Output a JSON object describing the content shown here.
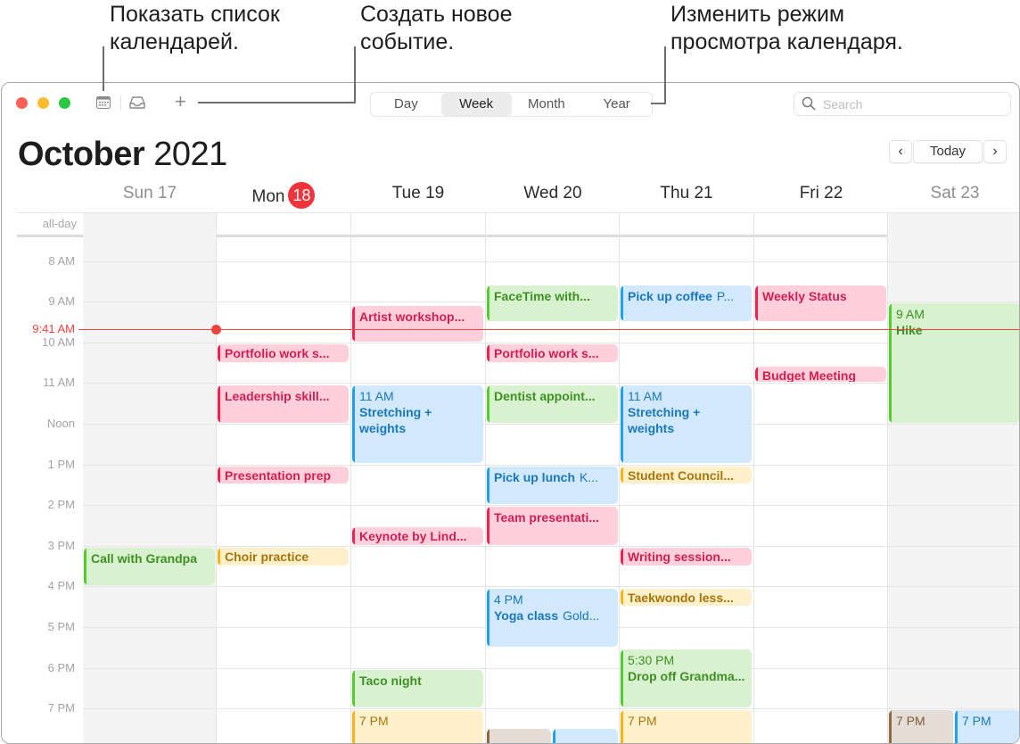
{
  "callouts": [
    {
      "text": "Показать список\nкалендарей."
    },
    {
      "text": "Создать новое\nсобытие."
    },
    {
      "text": "Изменить режим\nпросмотра календаря."
    }
  ],
  "toolbar": {
    "calendars_icon": "calendar-list-icon",
    "inbox_icon": "inbox-icon",
    "add_icon": "plus-icon",
    "add_label": "+",
    "views": [
      {
        "label": "Day",
        "active": false
      },
      {
        "label": "Week",
        "active": true
      },
      {
        "label": "Month",
        "active": false
      },
      {
        "label": "Year",
        "active": false
      }
    ],
    "search_placeholder": "Search"
  },
  "header": {
    "month": "October",
    "year": "2021",
    "prev_label": "‹",
    "today_label": "Today",
    "next_label": "›"
  },
  "days": [
    {
      "label": "Sun 17",
      "weekend": true
    },
    {
      "label": "Mon",
      "badge": "18",
      "today": true
    },
    {
      "label": "Tue 19"
    },
    {
      "label": "Wed 20"
    },
    {
      "label": "Thu 21"
    },
    {
      "label": "Fri 22"
    },
    {
      "label": "Sat 23",
      "weekend": true
    }
  ],
  "allday_label": "all-day",
  "hours": [
    "8 AM",
    "9 AM",
    "10 AM",
    "11 AM",
    "Noon",
    "1 PM",
    "2 PM",
    "3 PM",
    "4 PM",
    "5 PM",
    "6 PM",
    "7 PM"
  ],
  "now": {
    "label": "9:41 AM",
    "time": 9.683
  },
  "colors": {
    "red": "#f4204f",
    "green": "#55cc2e",
    "blue": "#1ea1f2",
    "yellow": "#fbb30f",
    "brown": "#8e6a42",
    "today": "#f1343b"
  },
  "events": [
    {
      "day": 0,
      "start": 15.05,
      "end": 16.0,
      "color": "green",
      "title": "Call with Grandpa"
    },
    {
      "day": 1,
      "start": 10.05,
      "end": 10.5,
      "color": "red",
      "title": "Portfolio work s..."
    },
    {
      "day": 1,
      "start": 11.05,
      "end": 12.0,
      "color": "red",
      "title": "Leadership skill..."
    },
    {
      "day": 1,
      "start": 13.05,
      "end": 13.5,
      "color": "red",
      "title": "Presentation prep"
    },
    {
      "day": 1,
      "start": 15.05,
      "end": 15.5,
      "color": "yellow",
      "title": "Choir practice"
    },
    {
      "day": 2,
      "start": 9.1,
      "end": 10.0,
      "color": "red",
      "title": "Artist workshop..."
    },
    {
      "day": 2,
      "start": 11.05,
      "end": 13.0,
      "color": "blue",
      "time": "11 AM",
      "title": "Stretching + weights",
      "wrap": true
    },
    {
      "day": 2,
      "start": 14.55,
      "end": 15.0,
      "color": "red",
      "title": "Keynote by Lind..."
    },
    {
      "day": 2,
      "start": 18.05,
      "end": 19.0,
      "color": "green",
      "title": "Taco night"
    },
    {
      "day": 2,
      "start": 19.05,
      "end": 20.0,
      "color": "yellow",
      "time": "7 PM"
    },
    {
      "day": 3,
      "start": 8.6,
      "end": 9.5,
      "color": "green",
      "title": "FaceTime with..."
    },
    {
      "day": 3,
      "start": 10.05,
      "end": 10.5,
      "color": "red",
      "title": "Portfolio work s..."
    },
    {
      "day": 3,
      "start": 11.05,
      "end": 12.0,
      "color": "green",
      "title": "Dentist appoint..."
    },
    {
      "day": 3,
      "start": 13.05,
      "end": 14.0,
      "color": "blue",
      "title": "Pick up lunch",
      "location": "K..."
    },
    {
      "day": 3,
      "start": 14.05,
      "end": 15.0,
      "color": "red",
      "title": "Team presentati..."
    },
    {
      "day": 3,
      "start": 16.05,
      "end": 17.5,
      "color": "blue",
      "time": "4 PM",
      "title": "Yoga class",
      "location": "Gold..."
    },
    {
      "day": 3,
      "start": 19.5,
      "end": 20.0,
      "color": "brown",
      "half": "left"
    },
    {
      "day": 3,
      "start": 19.5,
      "end": 20.0,
      "color": "blue",
      "half": "right"
    },
    {
      "day": 4,
      "start": 8.6,
      "end": 9.5,
      "color": "blue",
      "title": "Pick up coffee",
      "location": "P..."
    },
    {
      "day": 4,
      "start": 11.05,
      "end": 13.0,
      "color": "blue",
      "time": "11 AM",
      "title": "Stretching + weights",
      "wrap": true
    },
    {
      "day": 4,
      "start": 13.05,
      "end": 13.5,
      "color": "yellow",
      "title": "Student Council..."
    },
    {
      "day": 4,
      "start": 15.05,
      "end": 15.5,
      "color": "red",
      "title": "Writing session..."
    },
    {
      "day": 4,
      "start": 16.05,
      "end": 16.5,
      "color": "yellow",
      "title": "Taekwondo less..."
    },
    {
      "day": 4,
      "start": 17.55,
      "end": 19.0,
      "color": "green",
      "time": "5:30 PM",
      "title": "Drop off Grandma...",
      "wrap": true
    },
    {
      "day": 4,
      "start": 19.05,
      "end": 20.0,
      "color": "yellow",
      "time": "7 PM"
    },
    {
      "day": 5,
      "start": 8.6,
      "end": 9.5,
      "color": "red",
      "title": "Weekly Status"
    },
    {
      "day": 5,
      "start": 10.6,
      "end": 11.0,
      "color": "red",
      "title": "Budget Meeting"
    },
    {
      "day": 6,
      "start": 9.05,
      "end": 12.0,
      "color": "green",
      "time": "9 AM",
      "title": "Hike"
    },
    {
      "day": 6,
      "start": 19.05,
      "end": 20.0,
      "color": "brown",
      "time": "7 PM",
      "half": "left"
    },
    {
      "day": 6,
      "start": 19.05,
      "end": 20.0,
      "color": "blue",
      "time": "7 PM",
      "half": "right"
    }
  ]
}
